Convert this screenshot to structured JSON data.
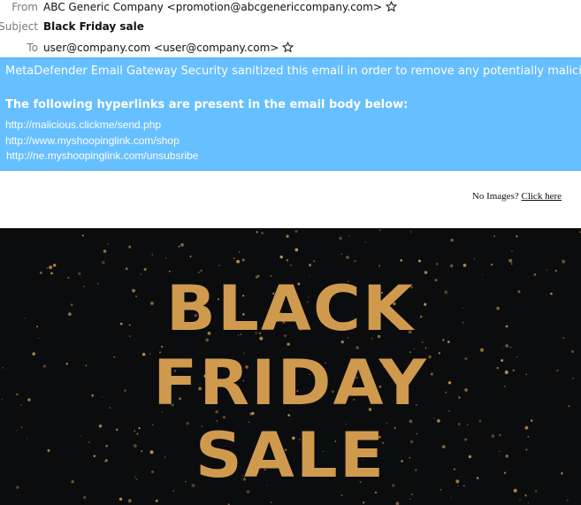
{
  "header": {
    "from_label": "From",
    "from_value": "ABC Generic Company <promotion@abcgenericcompany.com>",
    "subject_label": "Subject",
    "subject_value": "Black Friday sale",
    "to_label": "To",
    "to_value": "user@company.com <user@company.com>"
  },
  "banner": {
    "notice": "MetaDefender Email Gateway Security sanitized this email in order to remove any potentially malicious e",
    "links_heading": "The following hyperlinks are present in the email body below:",
    "links": [
      "http://malicious.clickme/send.php",
      "http://www.myshoopinglink.com/shop",
      "http://ne.myshoopinglink.com/unsubsribe"
    ]
  },
  "no_images": {
    "prompt": "No Images?",
    "link": "Click here"
  },
  "hero": {
    "line1": "BLACK",
    "line2": "FRIDAY",
    "line3": "SALE"
  },
  "colors": {
    "banner_bg": "#66bfff",
    "hero_bg": "#0b0c0e",
    "gold": "#d09a4e"
  }
}
